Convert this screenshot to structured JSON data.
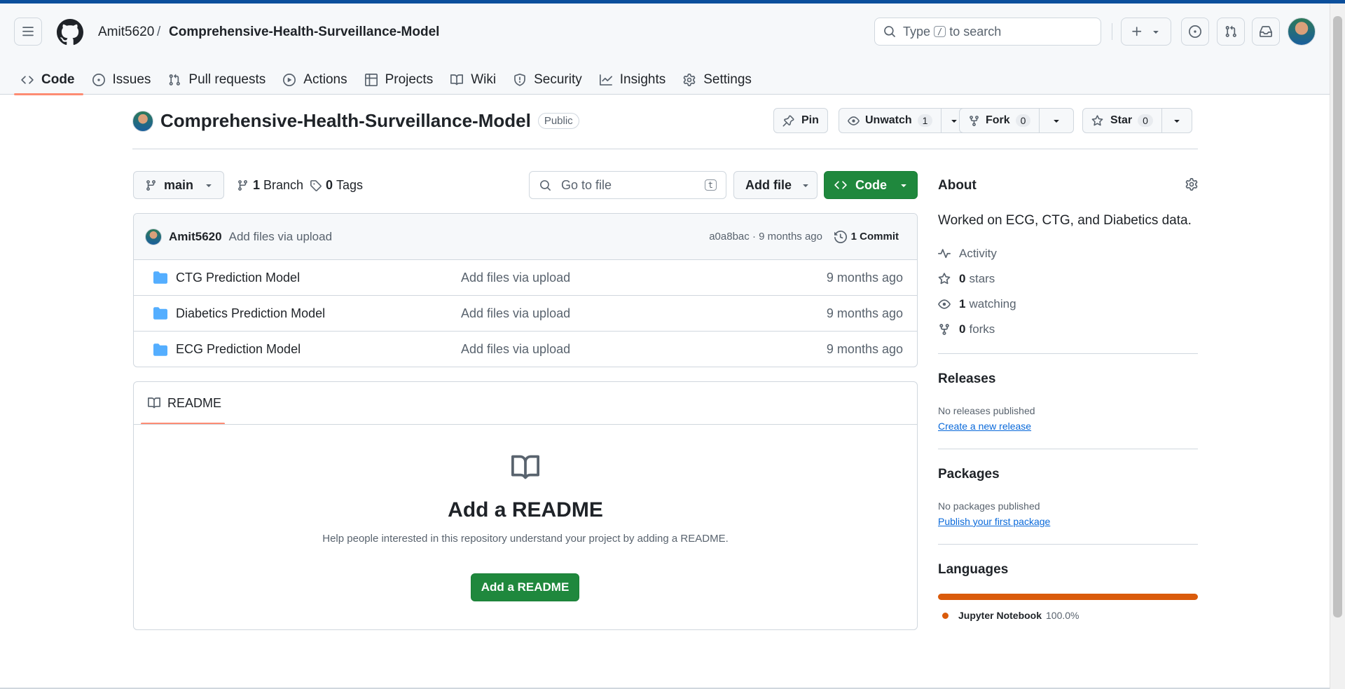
{
  "header": {
    "owner": "Amit5620",
    "separator": "/",
    "repo": "Comprehensive-Health-Surveillance-Model",
    "search_prefix": "Type",
    "search_key": "/",
    "search_suffix": "to search"
  },
  "tabs": [
    {
      "label": "Code",
      "icon": "code-icon"
    },
    {
      "label": "Issues",
      "icon": "issue-opened-icon"
    },
    {
      "label": "Pull requests",
      "icon": "git-pull-request-icon"
    },
    {
      "label": "Actions",
      "icon": "play-icon"
    },
    {
      "label": "Projects",
      "icon": "table-icon"
    },
    {
      "label": "Wiki",
      "icon": "book-icon"
    },
    {
      "label": "Security",
      "icon": "shield-icon"
    },
    {
      "label": "Insights",
      "icon": "graph-icon"
    },
    {
      "label": "Settings",
      "icon": "gear-icon"
    }
  ],
  "repo_header": {
    "title": "Comprehensive-Health-Surveillance-Model",
    "visibility": "Public",
    "pin_label": "Pin",
    "unwatch_label": "Unwatch",
    "watch_count": "1",
    "fork_label": "Fork",
    "fork_count": "0",
    "star_label": "Star",
    "star_count": "0"
  },
  "toolbar": {
    "branch": "main",
    "branches_count": "1",
    "branches_label": "Branch",
    "tags_count": "0",
    "tags_label": "Tags",
    "goto_placeholder": "Go to file",
    "goto_key": "t",
    "add_file_label": "Add file",
    "code_label": "Code"
  },
  "latest_commit": {
    "author": "Amit5620",
    "message": "Add files via upload",
    "meta": "a0a8bac · 9 months ago",
    "commit_count_label": "1 Commit"
  },
  "files": [
    {
      "name": "CTG Prediction Model",
      "message": "Add files via upload",
      "date": "9 months ago"
    },
    {
      "name": "Diabetics Prediction Model",
      "message": "Add files via upload",
      "date": "9 months ago"
    },
    {
      "name": "ECG Prediction Model",
      "message": "Add files via upload",
      "date": "9 months ago"
    }
  ],
  "readme": {
    "tab_label": "README",
    "heading": "Add a README",
    "description": "Help people interested in this repository understand your project by adding a README.",
    "button_label": "Add a README"
  },
  "about": {
    "title": "About",
    "description": "Worked on ECG, CTG, and Diabetics data.",
    "activity_label": "Activity",
    "stars_count": "0",
    "stars_label": "stars",
    "watching_count": "1",
    "watching_label": "watching",
    "forks_count": "0",
    "forks_label": "forks"
  },
  "releases": {
    "title": "Releases",
    "empty_text": "No releases published",
    "link": "Create a new release"
  },
  "packages": {
    "title": "Packages",
    "empty_text": "No packages published",
    "link": "Publish your first package"
  },
  "languages": {
    "title": "Languages",
    "items": [
      {
        "name": "Jupyter Notebook",
        "percent": "100.0%",
        "color": "#DA5B0B"
      }
    ]
  },
  "colors": {
    "primary_green": "#1f883d",
    "link_blue": "#0969da",
    "tab_underline": "#fd8c73",
    "folder_blue": "#54aeff"
  }
}
